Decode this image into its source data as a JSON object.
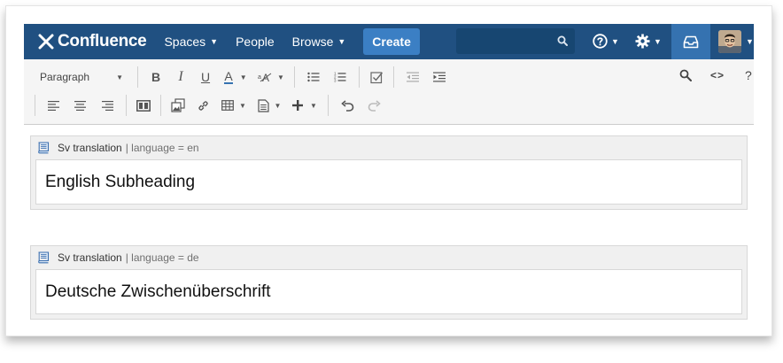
{
  "header": {
    "brand": "Confluence",
    "nav": [
      {
        "label": "Spaces",
        "has_caret": true
      },
      {
        "label": "People",
        "has_caret": false
      },
      {
        "label": "Browse",
        "has_caret": true
      }
    ],
    "create_label": "Create",
    "search_placeholder": "",
    "bg_color": "#205081"
  },
  "toolbar": {
    "paragraph_label": "Paragraph",
    "bold": "B",
    "italic": "I",
    "underline": "U",
    "text_color": "A",
    "source_label": "<>",
    "help_label": "?"
  },
  "macros": [
    {
      "name": "Sv translation",
      "params": "| language = en",
      "content": "English Subheading"
    },
    {
      "name": "Sv translation",
      "params": "| language = de",
      "content": "Deutsche Zwischenüberschrift"
    }
  ]
}
